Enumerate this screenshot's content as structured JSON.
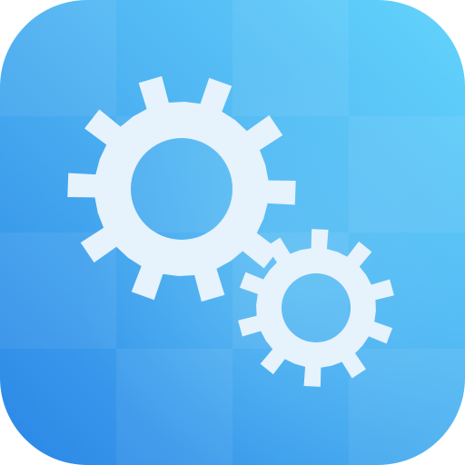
{
  "icon": {
    "name": "settings-gears-icon",
    "colors": {
      "background_top_right": "#5FD1FB",
      "background_center": "#4FB4F2",
      "background_bottom_left": "#2A86E6",
      "gear_fill": "#E6F2FC",
      "gear_hole": "#5EBBF2"
    }
  }
}
